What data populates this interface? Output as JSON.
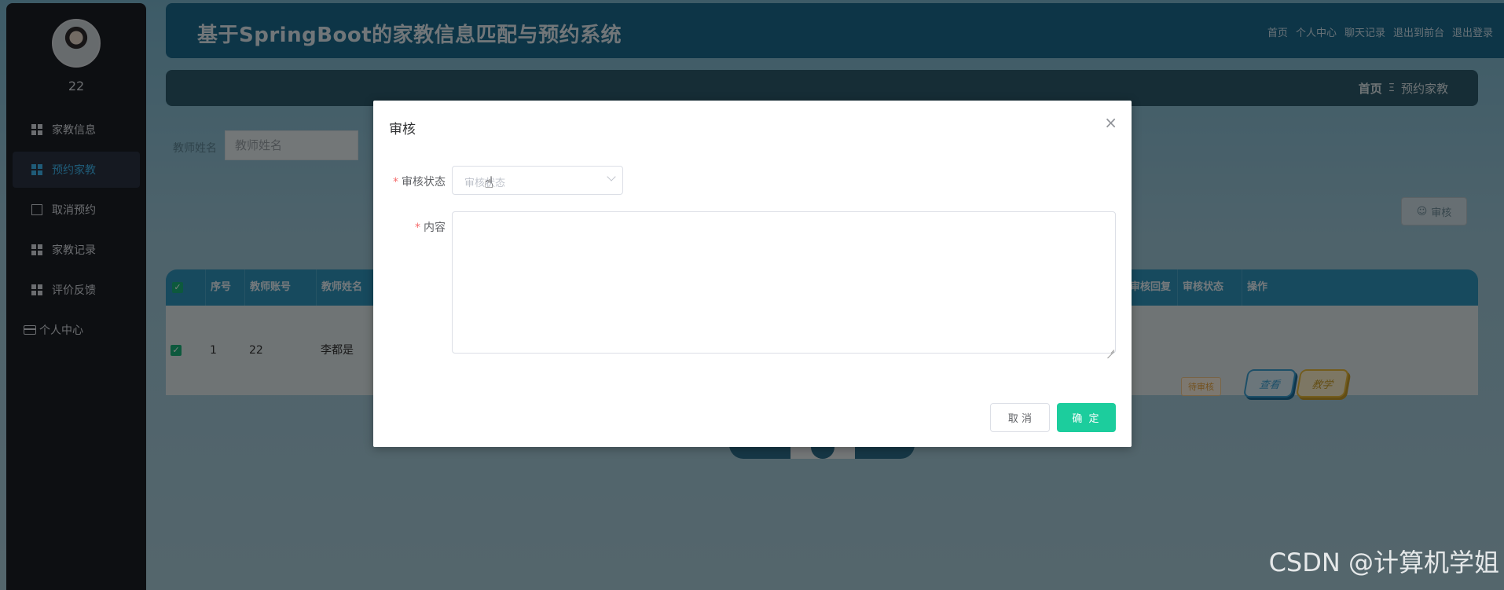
{
  "sidebar": {
    "username": "22",
    "items": [
      {
        "label": "家教信息",
        "icon": "grid-icon"
      },
      {
        "label": "预约家教",
        "icon": "grid-icon"
      },
      {
        "label": "取消预约",
        "icon": "chart-icon"
      },
      {
        "label": "家教记录",
        "icon": "grid-icon"
      },
      {
        "label": "评价反馈",
        "icon": "table-icon"
      },
      {
        "label": "个人中心",
        "icon": "card-icon"
      }
    ]
  },
  "header": {
    "title": "基于SpringBoot的家教信息匹配与预约系统",
    "links": [
      "首页",
      "个人中心",
      "聊天记录",
      "退出到前台",
      "退出登录"
    ]
  },
  "breadcrumb": {
    "home": "首页",
    "separator": "Ξ",
    "current": "预约家教"
  },
  "search": {
    "label": "教师姓名",
    "placeholder": "教师姓名"
  },
  "toolbar": {
    "review_label": "审核"
  },
  "table": {
    "headers": [
      "序号",
      "教师账号",
      "教师姓名",
      "审核回复",
      "审核状态",
      "操作"
    ],
    "rows": [
      {
        "index": "1",
        "account": "22",
        "name": "李都是",
        "status": "待审核",
        "view_label": "查看",
        "teach_label": "教学"
      }
    ]
  },
  "modal": {
    "title": "审核",
    "status_label": "审核状态",
    "status_placeholder": "审核状态",
    "content_label": "内容",
    "cancel_label": "取 消",
    "confirm_label": "确 定"
  },
  "watermark": "CSDN @计算机学姐",
  "colors": {
    "accent": "#1ccd9d",
    "header": "#1b6a8e",
    "sidebar": "#1b1e25",
    "active_menu": "#3fb7f0"
  }
}
